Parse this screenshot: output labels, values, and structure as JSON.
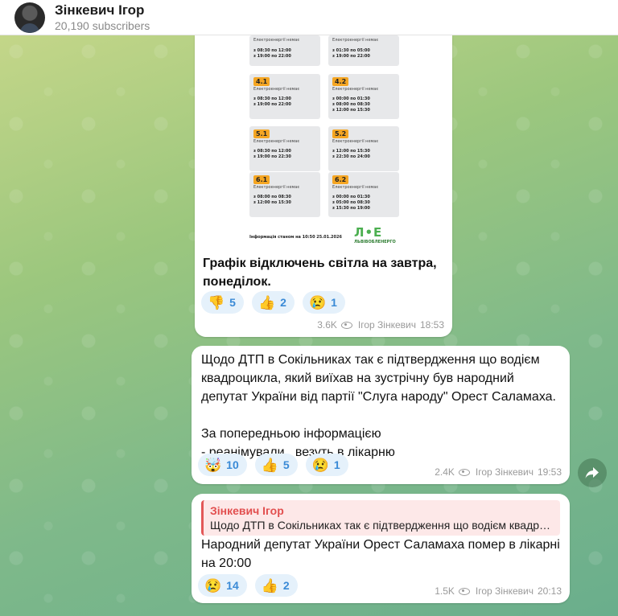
{
  "header": {
    "channel_name": "Зінкевич Ігор",
    "subscribers": "20,190 subscribers"
  },
  "post1": {
    "schedule_cards": [
      {
        "tag": "",
        "no_power": "Електроенергії немає",
        "times": "з 08:30 по 12:00\nз 19:00 по 22:00"
      },
      {
        "tag": "",
        "no_power": "Електроенергії немає",
        "times": "з 01:30 по 05:00\nз 19:00 по 22:00"
      },
      {
        "tag": "4.1",
        "no_power": "Електроенергії немає",
        "times": "з 08:30 по 12:00\nз 19:00 по 22:00"
      },
      {
        "tag": "4.2",
        "no_power": "Електроенергії немає",
        "times": "з 00:00 по 01:30\nз 08:00 по 08:30\nз 12:00 по 15:30"
      },
      {
        "tag": "5.1",
        "no_power": "Електроенергії немає",
        "times": "з 08:30 по 12:00\nз 19:00 по 22:30"
      },
      {
        "tag": "5.2",
        "no_power": "Електроенергії немає",
        "times": "з 12:00 по 15:30\nз 22:30 по 24:00"
      },
      {
        "tag": "6.1",
        "no_power": "Електроенергії немає",
        "times": "з 08:00 по 08:30\nз 12:00 по 15:30"
      },
      {
        "tag": "6.2",
        "no_power": "Електроенергії немає",
        "times": "з 00:00 по 01:30\nз 05:00 по 08:30\nз 15:30 по 19:00"
      }
    ],
    "info_line": "Інформація станом на 10:50 25.01.2026",
    "logo_mark": "Л•Е",
    "logo_text": "ЛЬВІВОБЛЕНЕРГО",
    "caption": "Графік відключень світла на завтра, понеділок.",
    "reactions": [
      {
        "emoji": "👎",
        "count": "5"
      },
      {
        "emoji": "👍",
        "count": "2"
      },
      {
        "emoji": "😢",
        "count": "1"
      }
    ],
    "views": "3.6K",
    "author": "Ігор Зінкевич",
    "time": "18:53"
  },
  "post2": {
    "text": "Щодо ДТП в Сокільниках так є підтвердження що водієм квадроцикла, який виїхав на зустрічну був народний депутат України від партії \"Слуга народу\" Орест Саламаха.\n\nЗа попередньою інформацією\n- реанімували , везуть в лікарню",
    "reactions": [
      {
        "emoji": "🤯",
        "count": "10"
      },
      {
        "emoji": "👍",
        "count": "5"
      },
      {
        "emoji": "😢",
        "count": "1"
      }
    ],
    "views": "2.4K",
    "author": "Ігор Зінкевич",
    "time": "19:53"
  },
  "post3": {
    "reply_name": "Зінкевич Ігор",
    "reply_text": "Щодо ДТП в Сокільниках так є підтвердження що водієм квадроцикла, який виїхав на зустрічну",
    "text": "Народний депутат України Орест Саламаха помер в лікарні на 20:00",
    "reactions": [
      {
        "emoji": "😢",
        "count": "14"
      },
      {
        "emoji": "👍",
        "count": "2"
      }
    ],
    "views": "1.5K",
    "author": "Ігор Зінкевич",
    "time": "20:13"
  },
  "share_icon": "share-arrow-icon"
}
